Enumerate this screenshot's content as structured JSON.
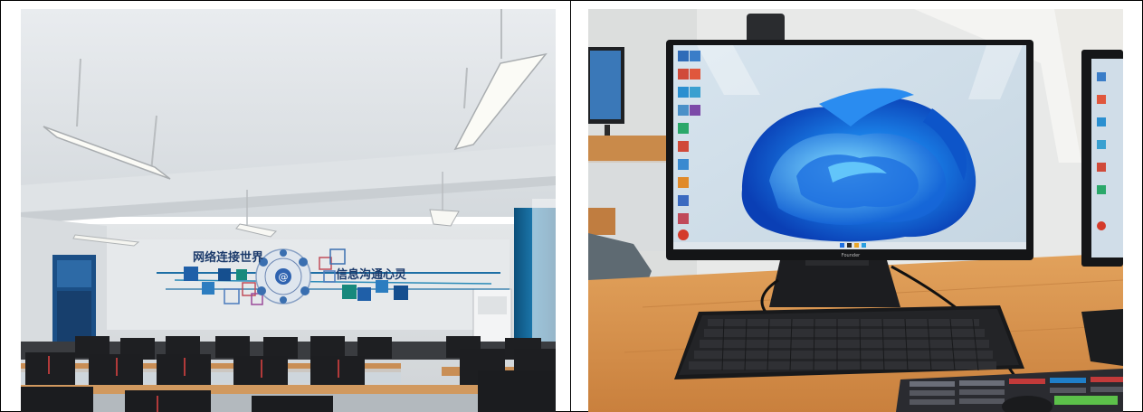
{
  "images": [
    {
      "subject": "computer classroom",
      "wall_slogan_left": "网络连接世界",
      "wall_slogan_right": "信息沟通心灵"
    },
    {
      "subject": "desktop computer",
      "monitor_brand": "Founder",
      "monitor_wallpaper": "Windows 11 bloom"
    }
  ]
}
